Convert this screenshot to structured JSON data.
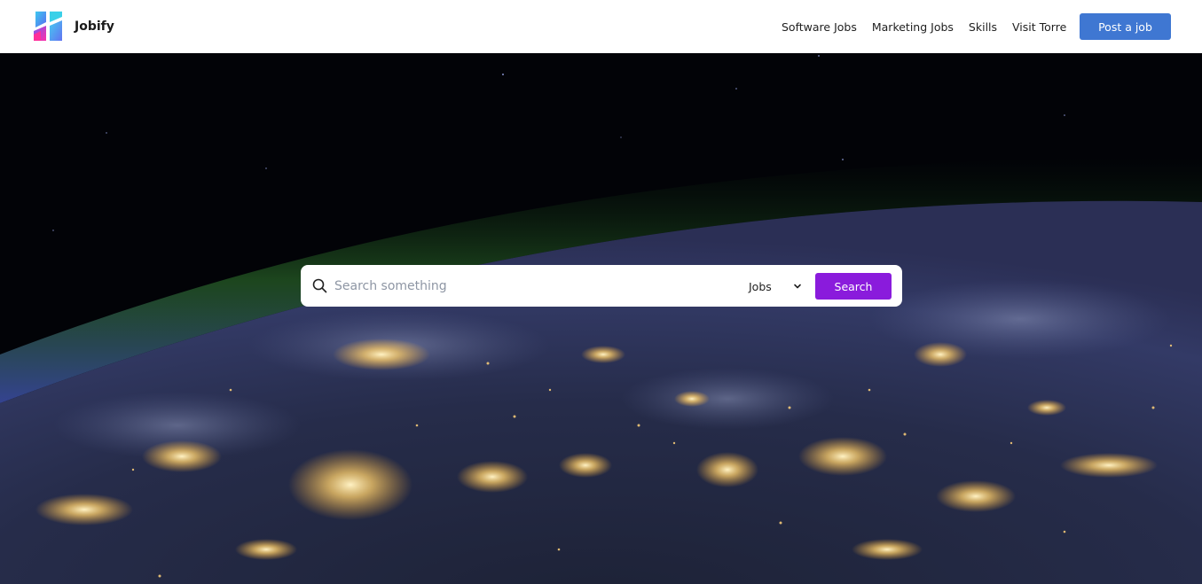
{
  "brand": {
    "name": "Jobify",
    "logo_icon": "jobify-logo-icon"
  },
  "nav": {
    "links": [
      {
        "label": "Software Jobs"
      },
      {
        "label": "Marketing Jobs"
      },
      {
        "label": "Skills"
      },
      {
        "label": "Visit Torre"
      }
    ],
    "post_job_label": "Post a job"
  },
  "hero": {
    "background_icon": "earth-at-night-image"
  },
  "search": {
    "placeholder": "Search something",
    "icon": "search-icon",
    "type_selected": "Jobs",
    "button_label": "Search"
  },
  "colors": {
    "primary_blue": "#3f77d2",
    "search_purple": "#8a1bdc",
    "navbar_bg": "#ffffff"
  }
}
